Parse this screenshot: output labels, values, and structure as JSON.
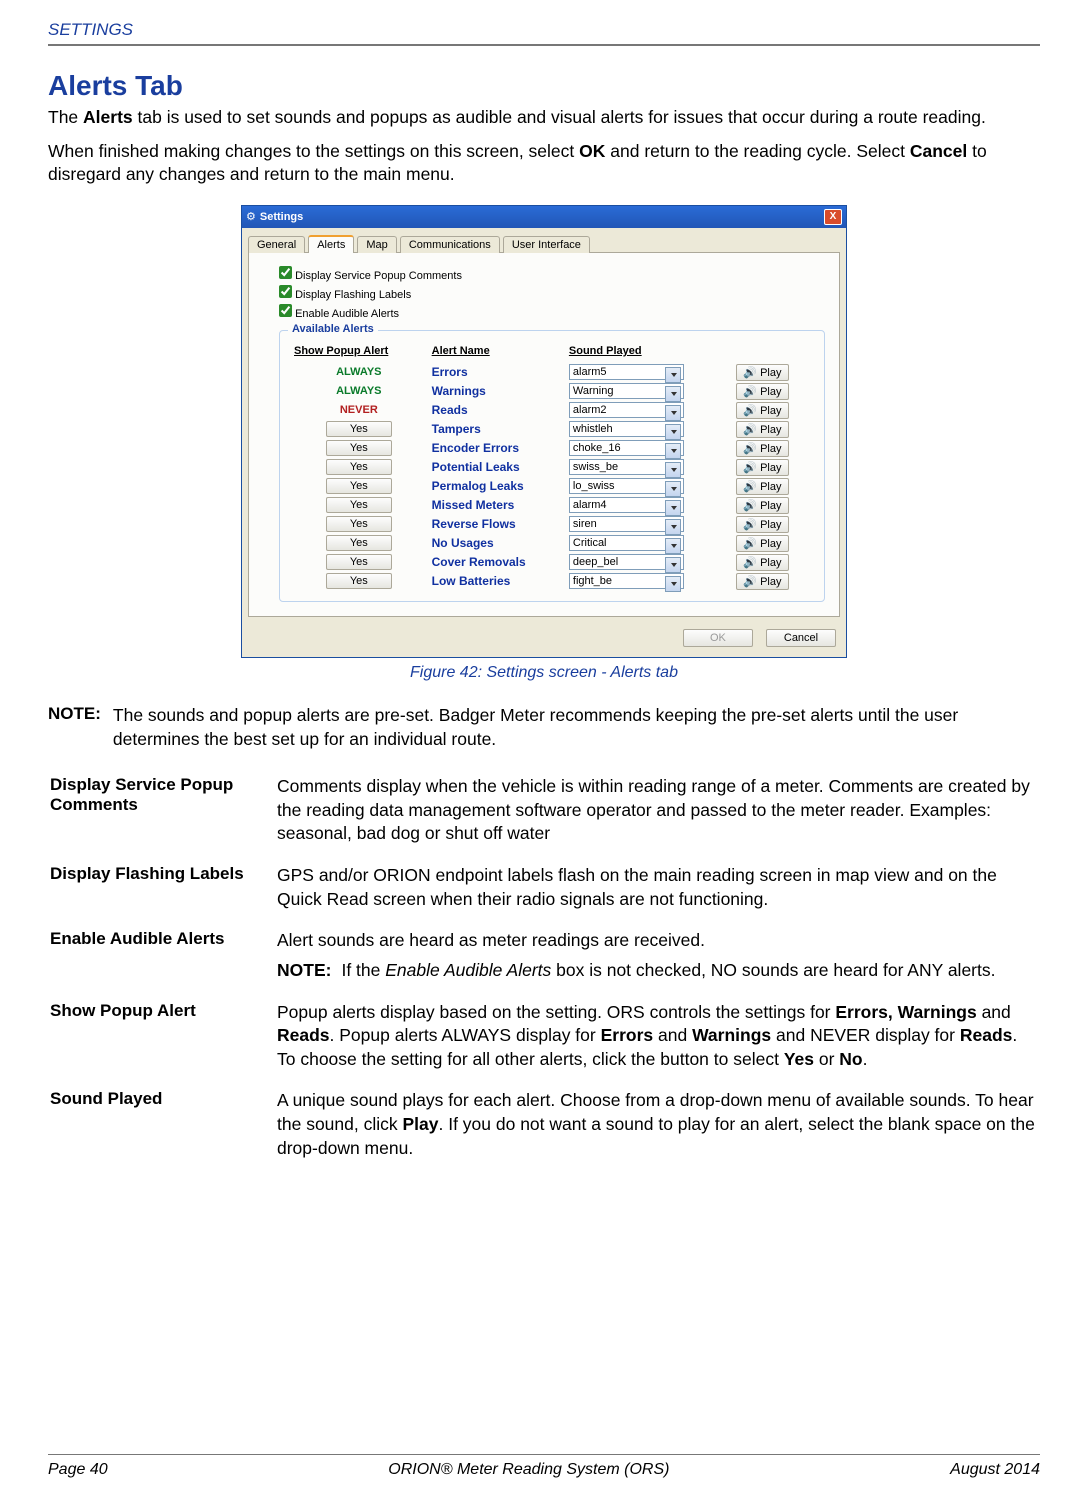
{
  "running_head": "SETTINGS",
  "section_title": "Alerts Tab",
  "intro_p1_a": "The ",
  "intro_p1_b_bold": "Alerts",
  "intro_p1_c": " tab is used to set sounds and popups as audible and visual alerts for issues that occur during a route reading.",
  "intro_p2_a": "When finished making changes to the settings on this screen, select ",
  "intro_p2_ok": "OK",
  "intro_p2_b": " and return to the reading cycle. Select ",
  "intro_p2_cancel": "Cancel",
  "intro_p2_c": " to disregard any changes and return to the main menu.",
  "figure_caption": "Figure 42:  Settings screen - Alerts tab",
  "note_label": "NOTE:",
  "note_text": "The sounds and popup alerts are pre-set. Badger Meter recommends keeping the pre-set alerts until the user determines the best set up for an individual route.",
  "settings_window": {
    "title": "Settings",
    "close": "X",
    "tabs": [
      "General",
      "Alerts",
      "Map",
      "Communications",
      "User Interface"
    ],
    "active_tab_index": 1,
    "checkboxes": [
      {
        "label": "Display Service Popup Comments",
        "checked": true
      },
      {
        "label": "Display Flashing Labels",
        "checked": true
      },
      {
        "label": "Enable Audible Alerts",
        "checked": true
      }
    ],
    "group_title": "Available Alerts",
    "columns": {
      "c0": "Show Popup Alert",
      "c1": "Alert Name",
      "c2": "Sound Played"
    },
    "always_label": "ALWAYS",
    "never_label": "NEVER",
    "yes_label": "Yes",
    "play_label": "Play",
    "rows": [
      {
        "popup_mode": "always",
        "name": "Errors",
        "sound": "alarm5"
      },
      {
        "popup_mode": "always",
        "name": "Warnings",
        "sound": "Warning"
      },
      {
        "popup_mode": "never",
        "name": "Reads",
        "sound": "alarm2"
      },
      {
        "popup_mode": "yes",
        "name": "Tampers",
        "sound": "whistleh"
      },
      {
        "popup_mode": "yes",
        "name": "Encoder Errors",
        "sound": "choke_16"
      },
      {
        "popup_mode": "yes",
        "name": "Potential Leaks",
        "sound": "swiss_be"
      },
      {
        "popup_mode": "yes",
        "name": "Permalog Leaks",
        "sound": "lo_swiss"
      },
      {
        "popup_mode": "yes",
        "name": "Missed Meters",
        "sound": "alarm4"
      },
      {
        "popup_mode": "yes",
        "name": "Reverse Flows",
        "sound": "siren"
      },
      {
        "popup_mode": "yes",
        "name": "No Usages",
        "sound": "Critical"
      },
      {
        "popup_mode": "yes",
        "name": "Cover Removals",
        "sound": "deep_bel"
      },
      {
        "popup_mode": "yes",
        "name": "Low Batteries",
        "sound": "fight_be"
      }
    ],
    "ok_label": "OK",
    "cancel_label": "Cancel"
  },
  "definitions": [
    {
      "term": "Display Service Popup Comments",
      "desc": "Comments display when the vehicle is within reading range of a meter. Comments are created by the reading data management software operator and passed to the meter reader. Examples: seasonal, bad dog or shut off water"
    },
    {
      "term": "Display Flashing Labels",
      "desc": "GPS and/or ORION endpoint labels flash on the main reading screen in map view and on the Quick Read screen when their radio signals are not functioning."
    },
    {
      "term": "Enable Audible Alerts",
      "desc": "Alert sounds are heard as meter readings are received.",
      "note_label": "NOTE:",
      "note_a": "If the ",
      "note_i": "Enable Audible Alerts",
      "note_b": " box is not checked, NO sounds are heard for ANY alerts."
    },
    {
      "term": "Show Popup Alert",
      "desc_a": "Popup alerts display based on the setting. ORS controls the settings for ",
      "b1": "Errors, Warnings",
      "desc_b": " and ",
      "b2": "Reads",
      "desc_c": ". Popup alerts ALWAYS display for ",
      "b3": "Errors",
      "desc_d": " and ",
      "b4": "Warnings",
      "desc_e": " and NEVER display for ",
      "b5": "Reads",
      "desc_f": ". To choose the setting for all other alerts, click the button to select ",
      "b6": "Yes",
      "desc_g": " or ",
      "b7": "No",
      "desc_h": "."
    },
    {
      "term": "Sound Played",
      "desc_a": "A unique sound plays for each alert. Choose from a drop-down menu of available sounds. To hear the sound, click ",
      "b1": "Play",
      "desc_b": ". If you do not want a sound to play for an alert, select the blank space on the drop-down menu."
    }
  ],
  "footer": {
    "left": "Page 40",
    "center": "ORION® Meter Reading System (ORS)",
    "right": "August  2014"
  }
}
